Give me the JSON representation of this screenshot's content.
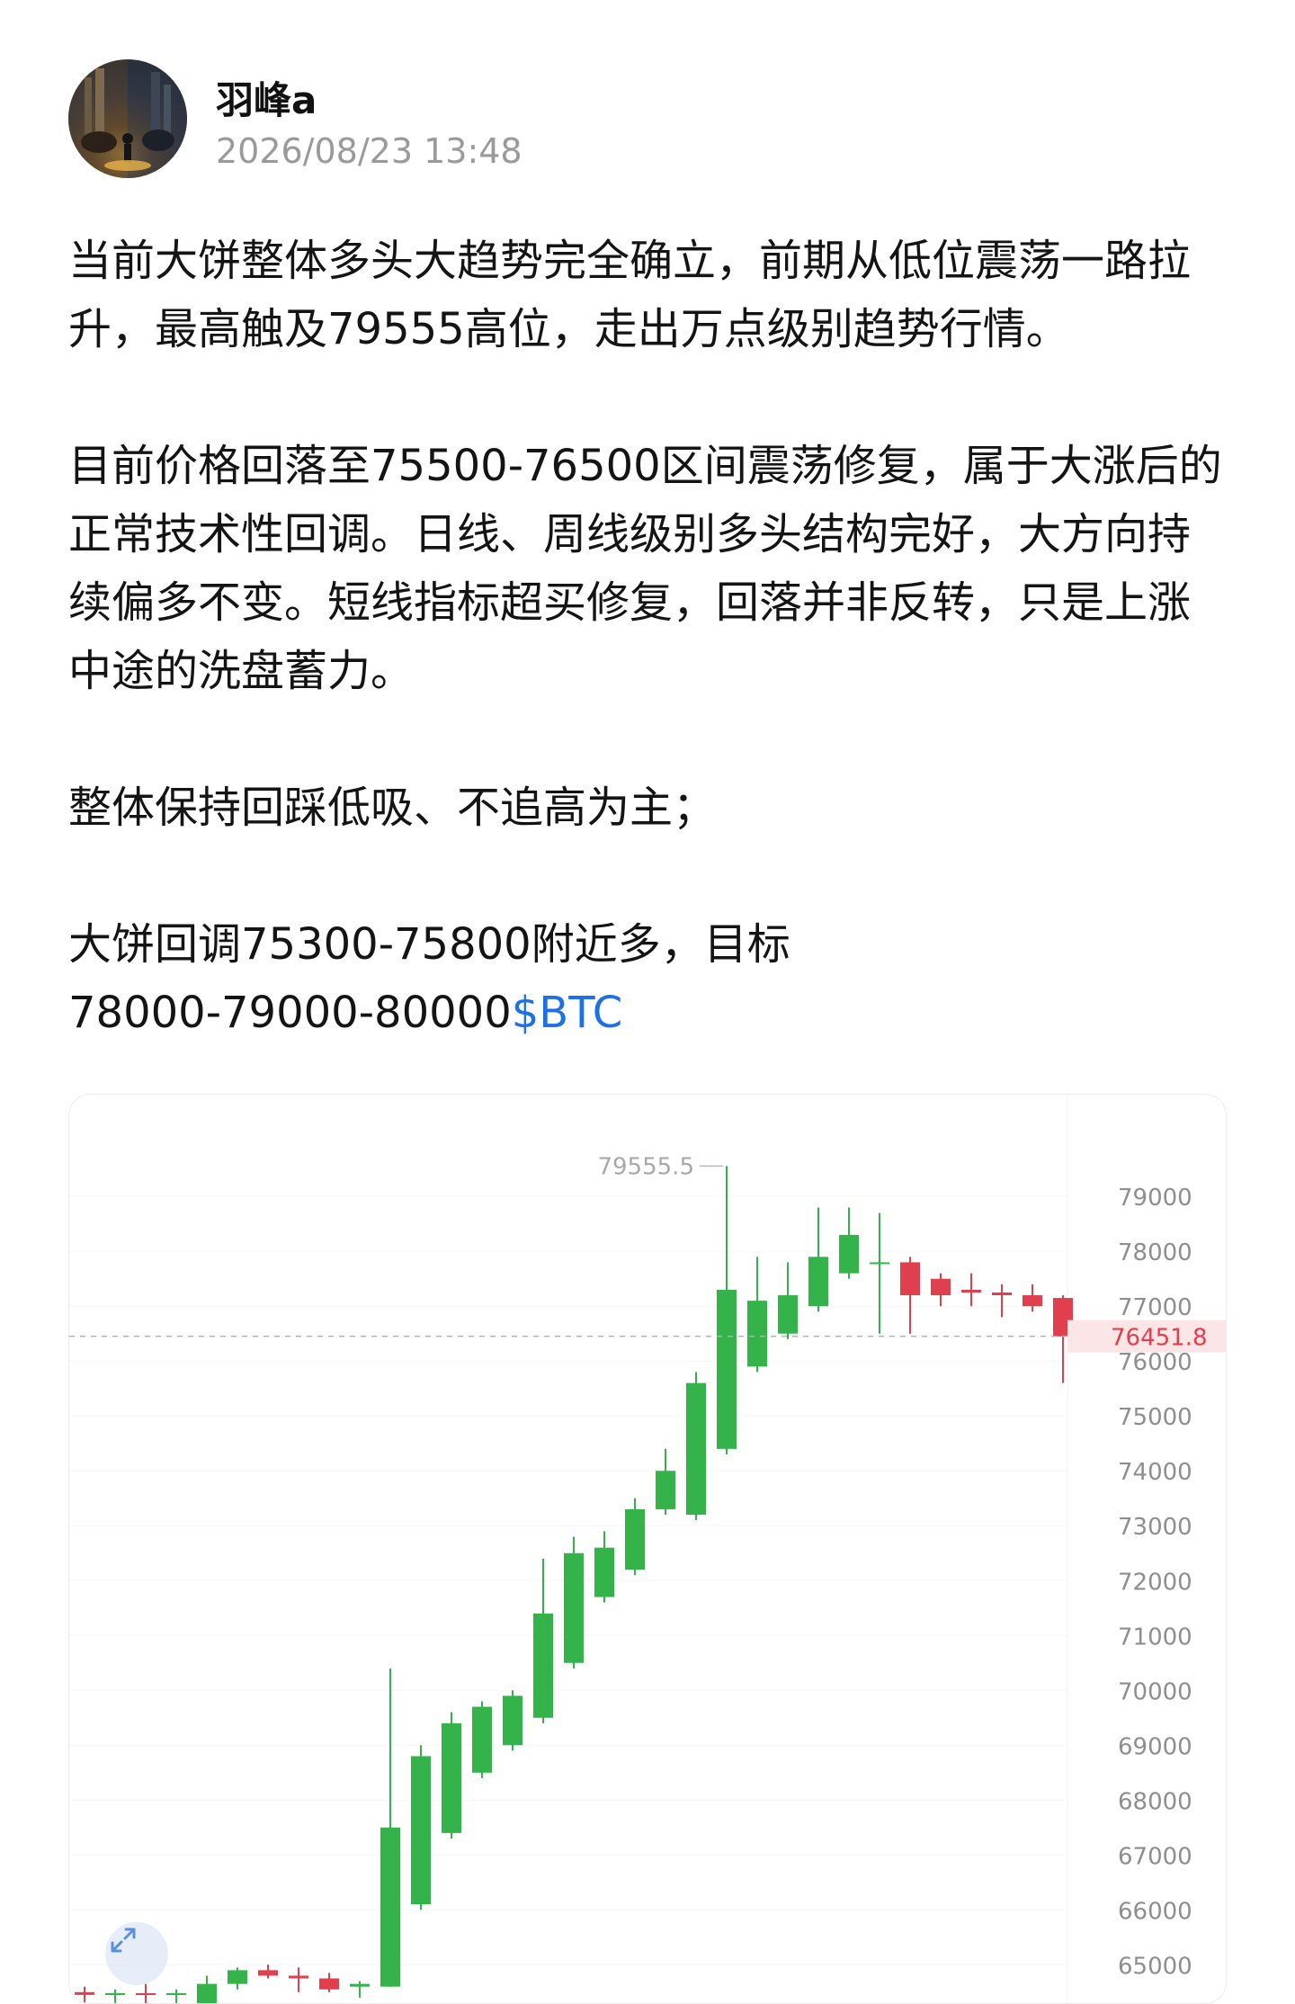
{
  "post": {
    "author": "羽峰a",
    "timestamp": "2026/08/23 13:48",
    "paragraphs": [
      "当前大饼整体多头大趋势完全确立，前期从低位震荡一路拉升，最高触及79555高位，走出万点级别趋势行情。",
      "目前价格回落至75500-76500区间震荡修复，属于大涨后的正常技术性回调。日线、周线级别多头结构完好，大方向持续偏多不变。短线指标超买修复，回落并非反转，只是上涨中途的洗盘蓄力。",
      "整体保持回踩低吸、不追高为主；"
    ],
    "last_paragraph_text": "大饼回调75300-75800附近多，目标\n78000-79000-80000",
    "ticker": "$BTC"
  },
  "colors": {
    "up": "#33b34a",
    "down": "#e03f4d",
    "ticker": "#1f6fe5",
    "price_tag_bg": "#fbe5e7",
    "price_tag_text": "#e03f4d"
  },
  "chart_data": {
    "type": "candlestick",
    "y_ticks": [
      "79000",
      "78000",
      "77000",
      "76000",
      "75000",
      "74000",
      "73000",
      "72000",
      "71000",
      "70000",
      "69000",
      "68000",
      "67000",
      "66000",
      "65000"
    ],
    "ylim": [
      64300,
      80200
    ],
    "high_label": "79555.5",
    "current_price": 76451.8,
    "current_price_label": "76451.8",
    "candles": [
      {
        "o": 64500,
        "h": 64600,
        "l": 64300,
        "c": 64450
      },
      {
        "o": 64450,
        "h": 64550,
        "l": 64300,
        "c": 64480
      },
      {
        "o": 64480,
        "h": 64650,
        "l": 64300,
        "c": 64470
      },
      {
        "o": 64470,
        "h": 64550,
        "l": 64300,
        "c": 64480
      },
      {
        "o": 64300,
        "h": 64800,
        "l": 64300,
        "c": 64650
      },
      {
        "o": 64650,
        "h": 64950,
        "l": 64550,
        "c": 64900
      },
      {
        "o": 64900,
        "h": 65000,
        "l": 64750,
        "c": 64800
      },
      {
        "o": 64800,
        "h": 64950,
        "l": 64500,
        "c": 64750
      },
      {
        "o": 64750,
        "h": 64850,
        "l": 64500,
        "c": 64550
      },
      {
        "o": 64600,
        "h": 64700,
        "l": 64400,
        "c": 64650
      },
      {
        "o": 64600,
        "h": 70400,
        "l": 64600,
        "c": 67500
      },
      {
        "o": 66100,
        "h": 69000,
        "l": 66000,
        "c": 68800
      },
      {
        "o": 67400,
        "h": 69600,
        "l": 67300,
        "c": 69400
      },
      {
        "o": 68500,
        "h": 69800,
        "l": 68400,
        "c": 69700
      },
      {
        "o": 69000,
        "h": 70000,
        "l": 68900,
        "c": 69900
      },
      {
        "o": 69500,
        "h": 72400,
        "l": 69400,
        "c": 71400
      },
      {
        "o": 70500,
        "h": 72800,
        "l": 70400,
        "c": 72500
      },
      {
        "o": 71700,
        "h": 72900,
        "l": 71600,
        "c": 72600
      },
      {
        "o": 72200,
        "h": 73500,
        "l": 72100,
        "c": 73300
      },
      {
        "o": 73300,
        "h": 74400,
        "l": 73200,
        "c": 74000
      },
      {
        "o": 73200,
        "h": 75800,
        "l": 73100,
        "c": 75600
      },
      {
        "o": 74400,
        "h": 79555.5,
        "l": 74300,
        "c": 77300
      },
      {
        "o": 75900,
        "h": 77900,
        "l": 75800,
        "c": 77100
      },
      {
        "o": 76500,
        "h": 77800,
        "l": 76400,
        "c": 77200
      },
      {
        "o": 77000,
        "h": 78800,
        "l": 76900,
        "c": 77900
      },
      {
        "o": 77600,
        "h": 78800,
        "l": 77500,
        "c": 78300
      },
      {
        "o": 77800,
        "h": 78700,
        "l": 76500,
        "c": 77800
      },
      {
        "o": 77800,
        "h": 77900,
        "l": 76500,
        "c": 77200
      },
      {
        "o": 77500,
        "h": 77600,
        "l": 77000,
        "c": 77200
      },
      {
        "o": 77300,
        "h": 77600,
        "l": 77000,
        "c": 77250
      },
      {
        "o": 77250,
        "h": 77400,
        "l": 76800,
        "c": 77200
      },
      {
        "o": 77200,
        "h": 77400,
        "l": 76900,
        "c": 77000
      },
      {
        "o": 77150,
        "h": 77200,
        "l": 75600,
        "c": 76450
      }
    ]
  }
}
